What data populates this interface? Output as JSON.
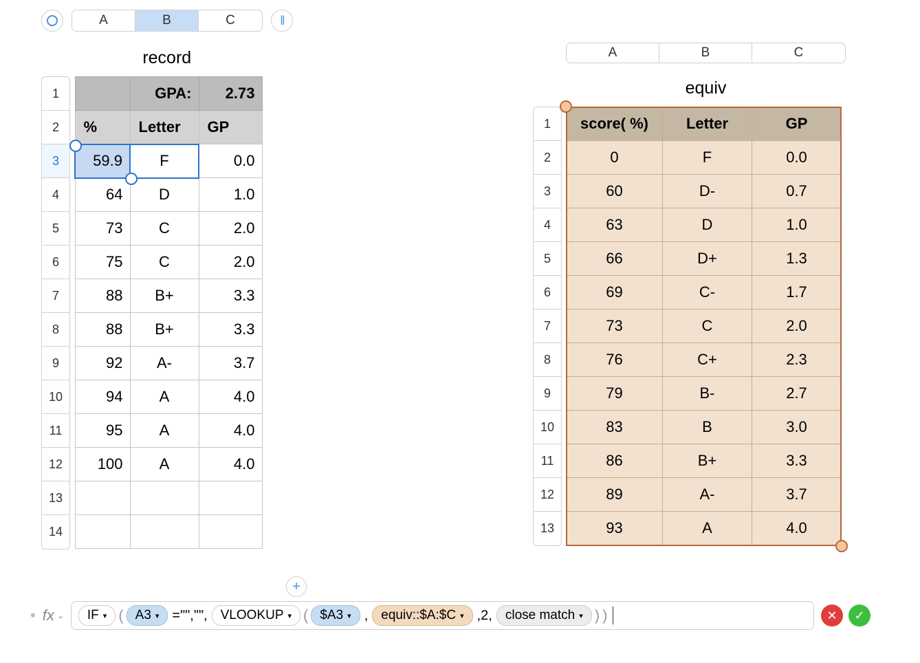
{
  "top_columns": [
    "A",
    "B",
    "C"
  ],
  "tables": {
    "record": {
      "title": "record",
      "gpa_label": "GPA:",
      "gpa_value": "2.73",
      "headers": {
        "pct": "%",
        "letter": "Letter",
        "gp": "GP"
      },
      "row_nums": [
        "1",
        "2",
        "3",
        "4",
        "5",
        "6",
        "7",
        "8",
        "9",
        "10",
        "11",
        "12",
        "13",
        "14"
      ],
      "rows": [
        {
          "pct": "59.9",
          "letter": "F",
          "gp": "0.0"
        },
        {
          "pct": "64",
          "letter": "D",
          "gp": "1.0"
        },
        {
          "pct": "73",
          "letter": "C",
          "gp": "2.0"
        },
        {
          "pct": "75",
          "letter": "C",
          "gp": "2.0"
        },
        {
          "pct": "88",
          "letter": "B+",
          "gp": "3.3"
        },
        {
          "pct": "88",
          "letter": "B+",
          "gp": "3.3"
        },
        {
          "pct": "92",
          "letter": "A-",
          "gp": "3.7"
        },
        {
          "pct": "94",
          "letter": "A",
          "gp": "4.0"
        },
        {
          "pct": "95",
          "letter": "A",
          "gp": "4.0"
        },
        {
          "pct": "100",
          "letter": "A",
          "gp": "4.0"
        }
      ]
    },
    "equiv": {
      "title": "equiv",
      "col_labels": [
        "A",
        "B",
        "C"
      ],
      "headers": {
        "score": "score( %)",
        "letter": "Letter",
        "gp": "GP"
      },
      "row_nums": [
        "1",
        "2",
        "3",
        "4",
        "5",
        "6",
        "7",
        "8",
        "9",
        "10",
        "11",
        "12",
        "13"
      ],
      "rows": [
        {
          "score": "0",
          "letter": "F",
          "gp": "0.0"
        },
        {
          "score": "60",
          "letter": "D-",
          "gp": "0.7"
        },
        {
          "score": "63",
          "letter": "D",
          "gp": "1.0"
        },
        {
          "score": "66",
          "letter": "D+",
          "gp": "1.3"
        },
        {
          "score": "69",
          "letter": "C-",
          "gp": "1.7"
        },
        {
          "score": "73",
          "letter": "C",
          "gp": "2.0"
        },
        {
          "score": "76",
          "letter": "C+",
          "gp": "2.3"
        },
        {
          "score": "79",
          "letter": "B-",
          "gp": "2.7"
        },
        {
          "score": "83",
          "letter": "B",
          "gp": "3.0"
        },
        {
          "score": "86",
          "letter": "B+",
          "gp": "3.3"
        },
        {
          "score": "89",
          "letter": "A-",
          "gp": "3.7"
        },
        {
          "score": "93",
          "letter": "A",
          "gp": "4.0"
        }
      ]
    }
  },
  "formula": {
    "fx": "fx",
    "if": "IF",
    "a3": "A3",
    "eq_empty": "=\"\",\"\",",
    "vlookup": "VLOOKUP",
    "da3": "$A3",
    "comma1": ",",
    "equiv_range": "equiv::$A:$C",
    "two": ",2,",
    "close_match": "close match",
    "p_open": "(",
    "p_close": ")"
  },
  "icons": {
    "circle": "◯",
    "pause": "‖",
    "plus": "+",
    "cancel": "✕",
    "confirm": "✓",
    "down": "▾",
    "chevron": "⌄"
  }
}
